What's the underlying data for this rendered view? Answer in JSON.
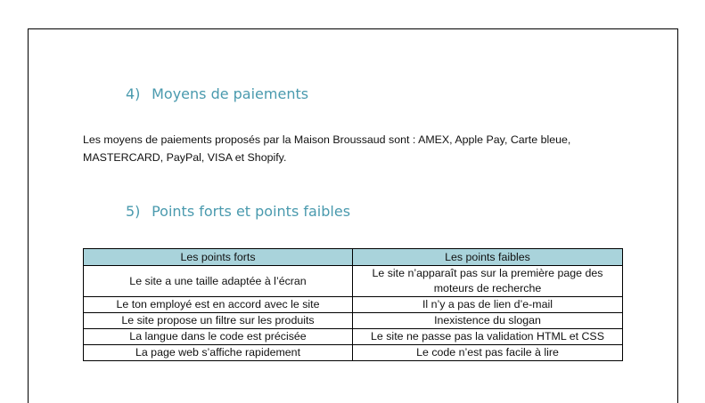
{
  "section4": {
    "number": "4)",
    "title": "Moyens de paiements",
    "paragraph_line1": "Les moyens de paiements proposés par la Maison Broussaud sont : AMEX, Apple Pay, Carte bleue,",
    "paragraph_line2": "MASTERCARD, PayPal, VISA et Shopify."
  },
  "section5": {
    "number": "5)",
    "title": "Points forts et points faibles"
  },
  "table": {
    "headers": [
      "Les points forts",
      "Les points faibles"
    ],
    "rows": [
      [
        "Le site a une taille adaptée à l’écran",
        "Le site n’apparaît pas sur la première page des moteurs de recherche"
      ],
      [
        "Le ton employé est en accord avec le site",
        "Il n’y a pas de lien d’e-mail"
      ],
      [
        "Le site propose un filtre sur les produits",
        "Inexistence du slogan"
      ],
      [
        "La langue dans le code est précisée",
        "Le site ne passe pas la validation HTML et CSS"
      ],
      [
        "La page web s’affiche rapidement",
        "Le code n’est pas facile à lire"
      ]
    ],
    "header_color": "#a9d3db"
  },
  "colors": {
    "heading": "#4a9aae",
    "text": "#111111"
  }
}
